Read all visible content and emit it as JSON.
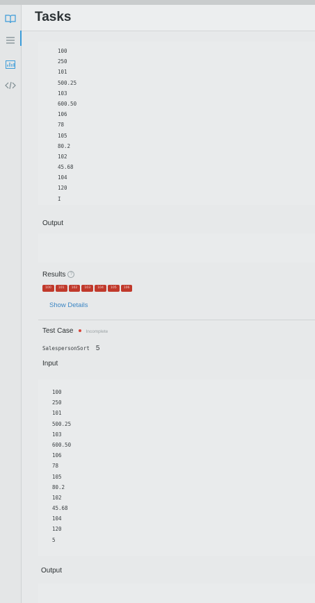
{
  "app": {
    "title": "Tasks"
  },
  "sidebar": {
    "icons": [
      "book-icon",
      "list-icon",
      "chart-icon",
      "code-icon"
    ],
    "active": "list-icon"
  },
  "top_input": {
    "lines": [
      "100",
      "250",
      "101",
      "500.25",
      "103",
      "600.50",
      "106",
      "78",
      "105",
      "80.2",
      "102",
      "45.68",
      "104",
      "120",
      "I"
    ]
  },
  "output_label": "Output",
  "results": {
    "label": "Results",
    "badges": [
      "100",
      "101",
      "102",
      "103",
      "104",
      "105",
      "106"
    ],
    "show_details": "Show Details"
  },
  "test_case": {
    "label": "Test Case",
    "status": "Incomplete",
    "name": "SalespersonSort",
    "number": "5"
  },
  "input_label": "Input",
  "bottom_input": {
    "lines": [
      "100",
      "250",
      "101",
      "500.25",
      "103",
      "600.50",
      "106",
      "78",
      "105",
      "80.2",
      "102",
      "45.68",
      "104",
      "120",
      "5"
    ]
  },
  "output_label_2": "Output",
  "colors": {
    "badge": "#c0392b",
    "link": "#3b86c4",
    "status_dot": "#d9453a",
    "active_bar": "#3a9bd9"
  }
}
